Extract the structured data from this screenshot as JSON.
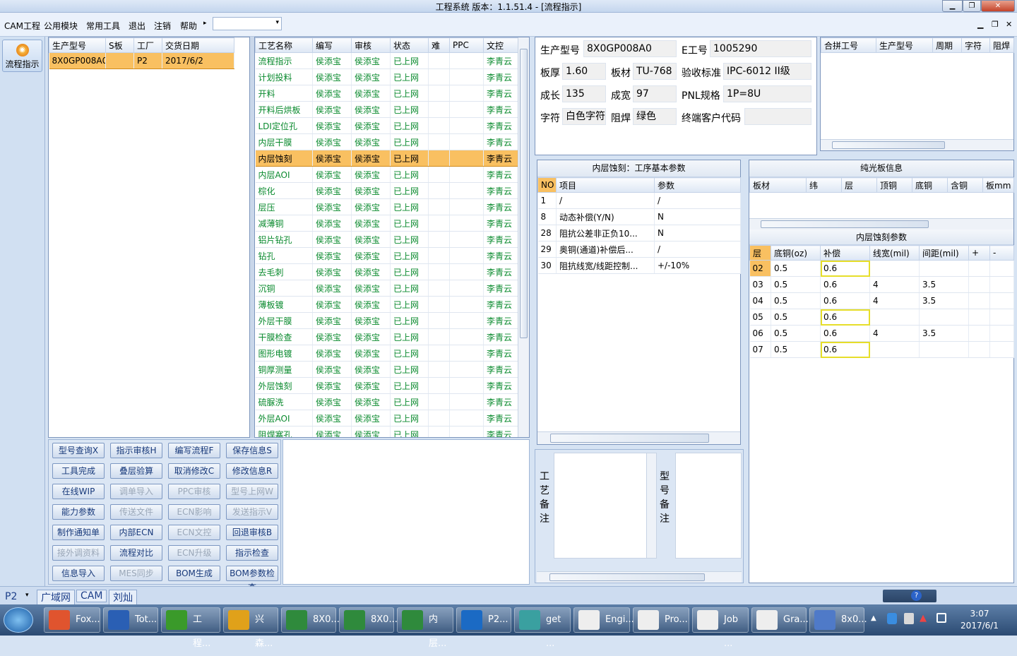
{
  "window": {
    "title": "工程系统  版本：1.1.51.4 - [流程指示]"
  },
  "menu": {
    "items": [
      "CAM工程",
      "公用模块",
      "常用工具",
      "退出",
      "注销",
      "帮助"
    ],
    "combo_value": ""
  },
  "left": {
    "flow_button": "流程指示"
  },
  "jobs": {
    "headers": [
      "生产型号",
      "S板",
      "工厂",
      "交货日期"
    ],
    "rows": [
      [
        "8X0GP008A0",
        "",
        "P2",
        "2017/6/2"
      ]
    ]
  },
  "process": {
    "headers": [
      "工艺名称",
      "编写",
      "审核",
      "状态",
      "难",
      "PPC",
      "文控"
    ],
    "rows": [
      [
        "流程指示",
        "侯添宝",
        "侯添宝",
        "已上网",
        "",
        "",
        "李青云"
      ],
      [
        "计划投料",
        "侯添宝",
        "侯添宝",
        "已上网",
        "",
        "",
        "李青云"
      ],
      [
        "开料",
        "侯添宝",
        "侯添宝",
        "已上网",
        "",
        "",
        "李青云"
      ],
      [
        "开料后烘板",
        "侯添宝",
        "侯添宝",
        "已上网",
        "",
        "",
        "李青云"
      ],
      [
        "LDI定位孔",
        "侯添宝",
        "侯添宝",
        "已上网",
        "",
        "",
        "李青云"
      ],
      [
        "内层干膜",
        "侯添宝",
        "侯添宝",
        "已上网",
        "",
        "",
        "李青云"
      ],
      [
        "内层蚀刻",
        "侯添宝",
        "侯添宝",
        "已上网",
        "",
        "",
        "李青云"
      ],
      [
        "内层AOI",
        "侯添宝",
        "侯添宝",
        "已上网",
        "",
        "",
        "李青云"
      ],
      [
        "棕化",
        "侯添宝",
        "侯添宝",
        "已上网",
        "",
        "",
        "李青云"
      ],
      [
        "层压",
        "侯添宝",
        "侯添宝",
        "已上网",
        "",
        "",
        "李青云"
      ],
      [
        "减薄铜",
        "侯添宝",
        "侯添宝",
        "已上网",
        "",
        "",
        "李青云"
      ],
      [
        "铝片钻孔",
        "侯添宝",
        "侯添宝",
        "已上网",
        "",
        "",
        "李青云"
      ],
      [
        "钻孔",
        "侯添宝",
        "侯添宝",
        "已上网",
        "",
        "",
        "李青云"
      ],
      [
        "去毛刺",
        "侯添宝",
        "侯添宝",
        "已上网",
        "",
        "",
        "李青云"
      ],
      [
        "沉铜",
        "侯添宝",
        "侯添宝",
        "已上网",
        "",
        "",
        "李青云"
      ],
      [
        "薄板镀",
        "侯添宝",
        "侯添宝",
        "已上网",
        "",
        "",
        "李青云"
      ],
      [
        "外层干膜",
        "侯添宝",
        "侯添宝",
        "已上网",
        "",
        "",
        "李青云"
      ],
      [
        "干膜检查",
        "侯添宝",
        "侯添宝",
        "已上网",
        "",
        "",
        "李青云"
      ],
      [
        "图形电镀",
        "侯添宝",
        "侯添宝",
        "已上网",
        "",
        "",
        "李青云"
      ],
      [
        "铜厚测量",
        "侯添宝",
        "侯添宝",
        "已上网",
        "",
        "",
        "李青云"
      ],
      [
        "外层蚀刻",
        "侯添宝",
        "侯添宝",
        "已上网",
        "",
        "",
        "李青云"
      ],
      [
        "硫脲洗",
        "侯添宝",
        "侯添宝",
        "已上网",
        "",
        "",
        "李青云"
      ],
      [
        "外层AOI",
        "侯添宝",
        "侯添宝",
        "已上网",
        "",
        "",
        "李青云"
      ],
      [
        "阻焊塞孔",
        "侯添宝",
        "侯添宝",
        "已上网",
        "",
        "",
        "李青云"
      ]
    ],
    "selected_index": 6
  },
  "buttons": [
    [
      "型号查询X",
      "指示审核H",
      "编写流程F",
      "保存信息S"
    ],
    [
      "工具完成",
      "叠层验算",
      "取消修改C",
      "修改信息R"
    ],
    [
      "在线WIP",
      "调单导入",
      "PPC审核",
      "型号上网W"
    ],
    [
      "能力参数",
      "传送文件",
      "ECN影响",
      "发送指示V"
    ],
    [
      "制作通知单",
      "内部ECN",
      "ECN文控",
      "回退审核B"
    ],
    [
      "接外调资料",
      "流程对比",
      "ECN升级",
      "指示检查"
    ],
    [
      "信息导入",
      "MES同步",
      "BOM生成",
      "BOM参数检查"
    ]
  ],
  "disabled_buttons": [
    "调单导入",
    "PPC审核",
    "型号上网W",
    "传送文件",
    "ECN影响",
    "发送指示V",
    "ECN文控",
    "接外调资料",
    "ECN升级",
    "MES同步"
  ],
  "info": {
    "prod_model_label": "生产型号",
    "prod_model": "8X0GP008A0",
    "e_job_label": "E工号",
    "e_job": "1005290",
    "thickness_label": "板厚",
    "thickness": "1.60",
    "material_label": "板材",
    "material": "TU-768",
    "standard_label": "验收标准",
    "standard": "IPC-6012 II级",
    "length_label": "成长",
    "length": "135",
    "width_label": "成宽",
    "width": "97",
    "pnl_label": "PNL规格",
    "pnl": "1P=8U",
    "char_label": "字符",
    "char": "白色字符",
    "mask_label": "阻焊",
    "mask": "绿色",
    "customer_label": "终端客户代码",
    "customer": ""
  },
  "merge": {
    "headers": [
      "合拼工号",
      "生产型号",
      "周期",
      "字符",
      "阻焊"
    ]
  },
  "params": {
    "title": "内层蚀刻：工序基本参数",
    "headers": [
      "NO",
      "项目",
      "参数"
    ],
    "rows": [
      [
        "1",
        "/",
        "/"
      ],
      [
        "8",
        "动态补偿(Y/N)",
        "N"
      ],
      [
        "28",
        "阻抗公差非正负10...",
        "N"
      ],
      [
        "29",
        "奥铜(通道)补偿后...",
        "/"
      ],
      [
        "30",
        "阻抗线宽/线距控制...",
        "+/-10%"
      ]
    ]
  },
  "plain": {
    "title": "纯光板信息",
    "headers": [
      "板材",
      "纬",
      "层",
      "顶铜",
      "底铜",
      "含铜",
      "板mm"
    ]
  },
  "etch": {
    "title": "内层蚀刻参数",
    "headers": [
      "层",
      "底铜(oz)",
      "补偿",
      "线宽(mil)",
      "间距(mil)",
      "+",
      "-"
    ],
    "rows": [
      [
        "02",
        "0.5",
        "0.6",
        "",
        "",
        "",
        ""
      ],
      [
        "03",
        "0.5",
        "0.6",
        "4",
        "3.5",
        "",
        ""
      ],
      [
        "04",
        "0.5",
        "0.6",
        "4",
        "3.5",
        "",
        ""
      ],
      [
        "05",
        "0.5",
        "0.6",
        "",
        "",
        "",
        ""
      ],
      [
        "06",
        "0.5",
        "0.6",
        "4",
        "3.5",
        "",
        ""
      ],
      [
        "07",
        "0.5",
        "0.6",
        "",
        "",
        "",
        ""
      ]
    ],
    "highlighted_rows": [
      0,
      3,
      5
    ]
  },
  "remarks": {
    "process_label": "工艺备注",
    "model_label": "型号备注"
  },
  "status": {
    "plant": "P2",
    "tabs": [
      "广域网",
      "CAM",
      "刘灿"
    ]
  },
  "taskbar": {
    "items": [
      "Fox...",
      "Tot...",
      "工程...",
      "兴森...",
      "8X0...",
      "8X0...",
      "内层...",
      "P2...",
      "get ...",
      "Engi...",
      "Pro...",
      "Job ...",
      "Gra...",
      "8x0..."
    ],
    "time": "3:07",
    "date": "2017/6/1"
  }
}
